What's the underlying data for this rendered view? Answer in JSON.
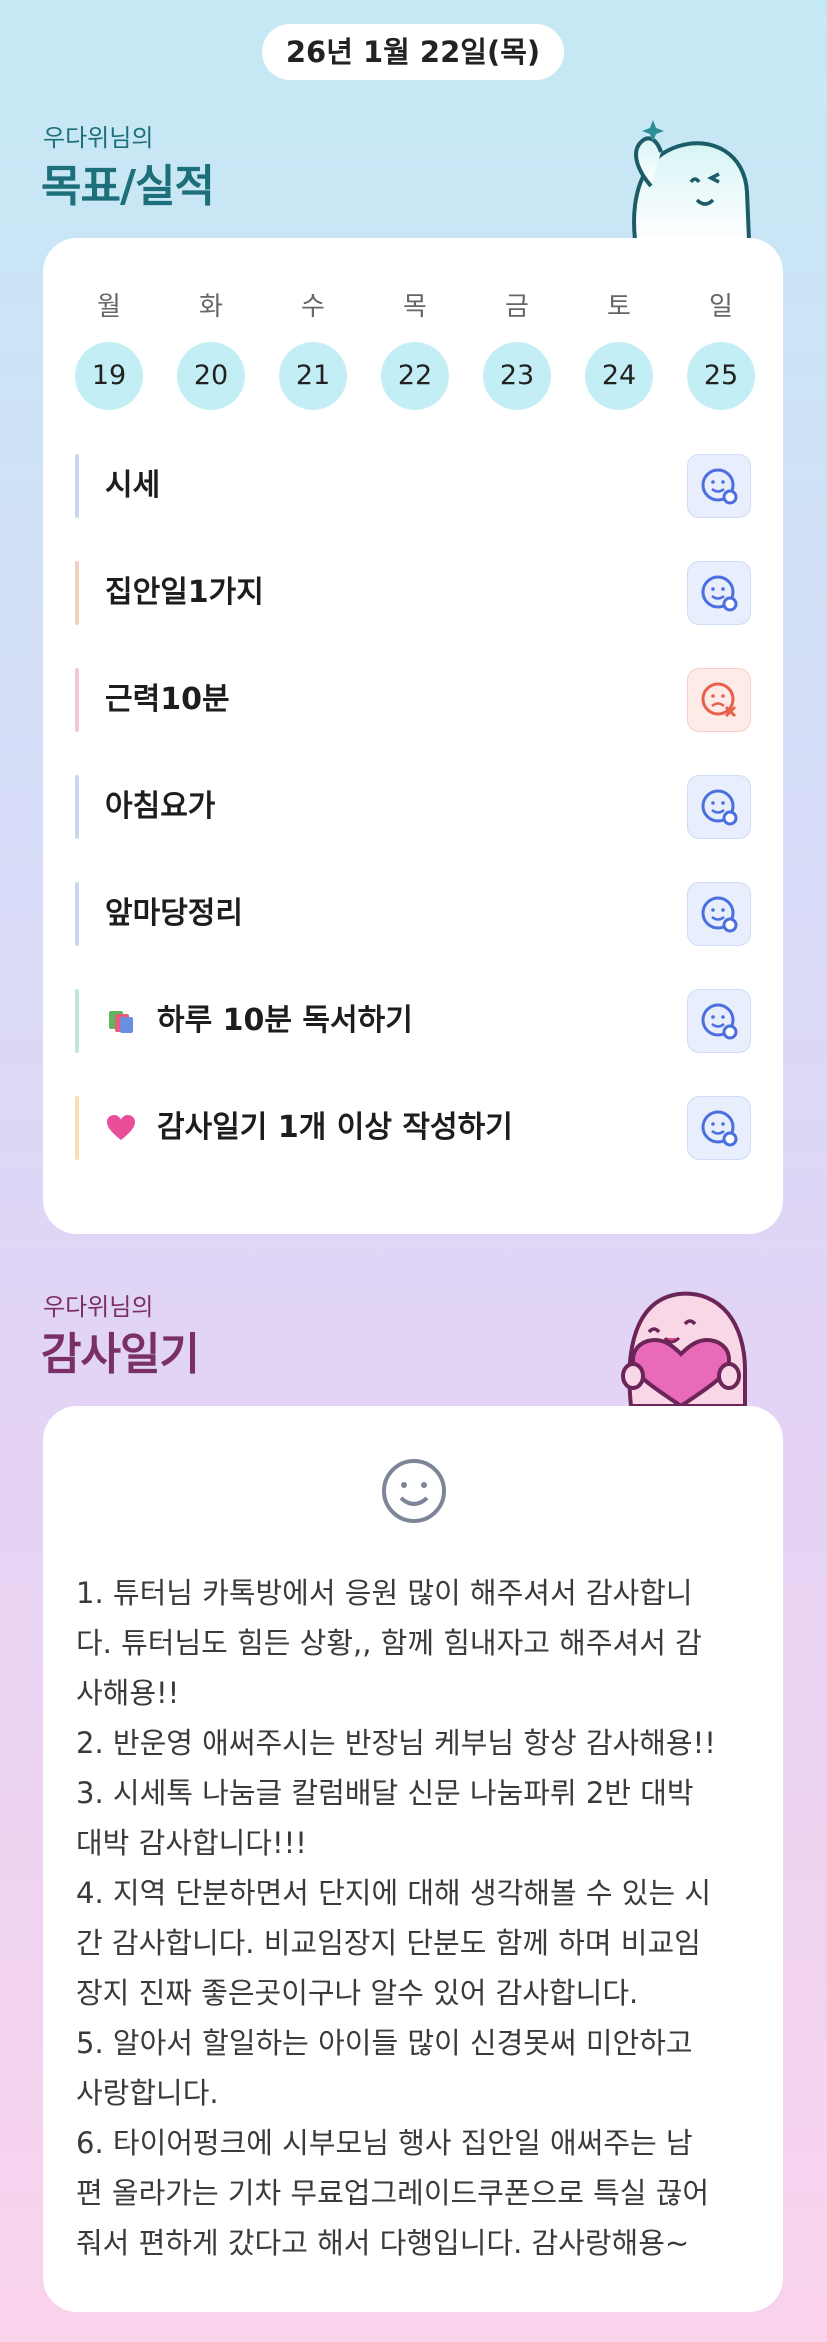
{
  "header": {
    "date": "26년 1월 22일(목)"
  },
  "goals_section": {
    "subtitle": "우다위님의",
    "title": "목표/실적"
  },
  "week": {
    "days": [
      {
        "label": "월",
        "num": "19"
      },
      {
        "label": "화",
        "num": "20"
      },
      {
        "label": "수",
        "num": "21"
      },
      {
        "label": "목",
        "num": "22"
      },
      {
        "label": "금",
        "num": "23"
      },
      {
        "label": "토",
        "num": "24"
      },
      {
        "label": "일",
        "num": "25"
      }
    ]
  },
  "goals": [
    {
      "text": "시세",
      "status": "achieved",
      "bar_color": "#c9d6ee"
    },
    {
      "text": "집안일1가지",
      "status": "achieved",
      "bar_color": "#f3cfc0"
    },
    {
      "text": "근력10분",
      "status": "not-achieved",
      "bar_color": "#f4c6dd"
    },
    {
      "text": "아침요가",
      "status": "achieved",
      "bar_color": "#c9d6ee"
    },
    {
      "text": "앞마당정리",
      "status": "achieved",
      "bar_color": "#c9d6ee"
    },
    {
      "text": "하루 10분 독서하기",
      "status": "achieved",
      "bar_color": "#bfe9d6",
      "emoji": "books-icon"
    },
    {
      "text": "감사일기 1개 이상 작성하기",
      "status": "achieved",
      "bar_color": "#f8dfb8",
      "emoji": "heart-icon"
    }
  ],
  "diary_section": {
    "subtitle": "우다위님의",
    "title": "감사일기"
  },
  "diary": {
    "mood_icon": "smile-icon",
    "text": "1. 튜터님 카톡방에서 응원 많이 해주셔서 감사합니\n다. 튜터님도 힘든 상황,, 함께 힘내자고 해주셔서 감\n사해용!!\n2. 반운영 애써주시는 반장님 케부님 항상 감사해용!!\n3. 시세톡 나눔글 칼럼배달 신문 나눔파뤼 2반 대박\n대박 감사합니다!!!\n4. 지역 단분하면서 단지에 대해 생각해볼 수 있는 시\n간 감사합니다. 비교임장지 단분도 함께 하며 비교임\n장지 진짜 좋은곳이구나 알수 있어 감사합니다.\n5. 알아서 할일하는 아이들 많이 신경못써 미안하고\n사랑합니다.\n6. 타이어펑크에 시부모님 행사 집안일 애써주는 남\n편 올라가는 기차 무료업그레이드쿠폰으로 특실 끊어\n줘서 편하게 갔다고 해서 다행입니다. 감사랑해용~"
  },
  "colors": {
    "goal_title": "#1d6f7a",
    "diary_title": "#7a2f66",
    "status_ok": "#4c6fe0",
    "status_fail": "#e8604c"
  }
}
